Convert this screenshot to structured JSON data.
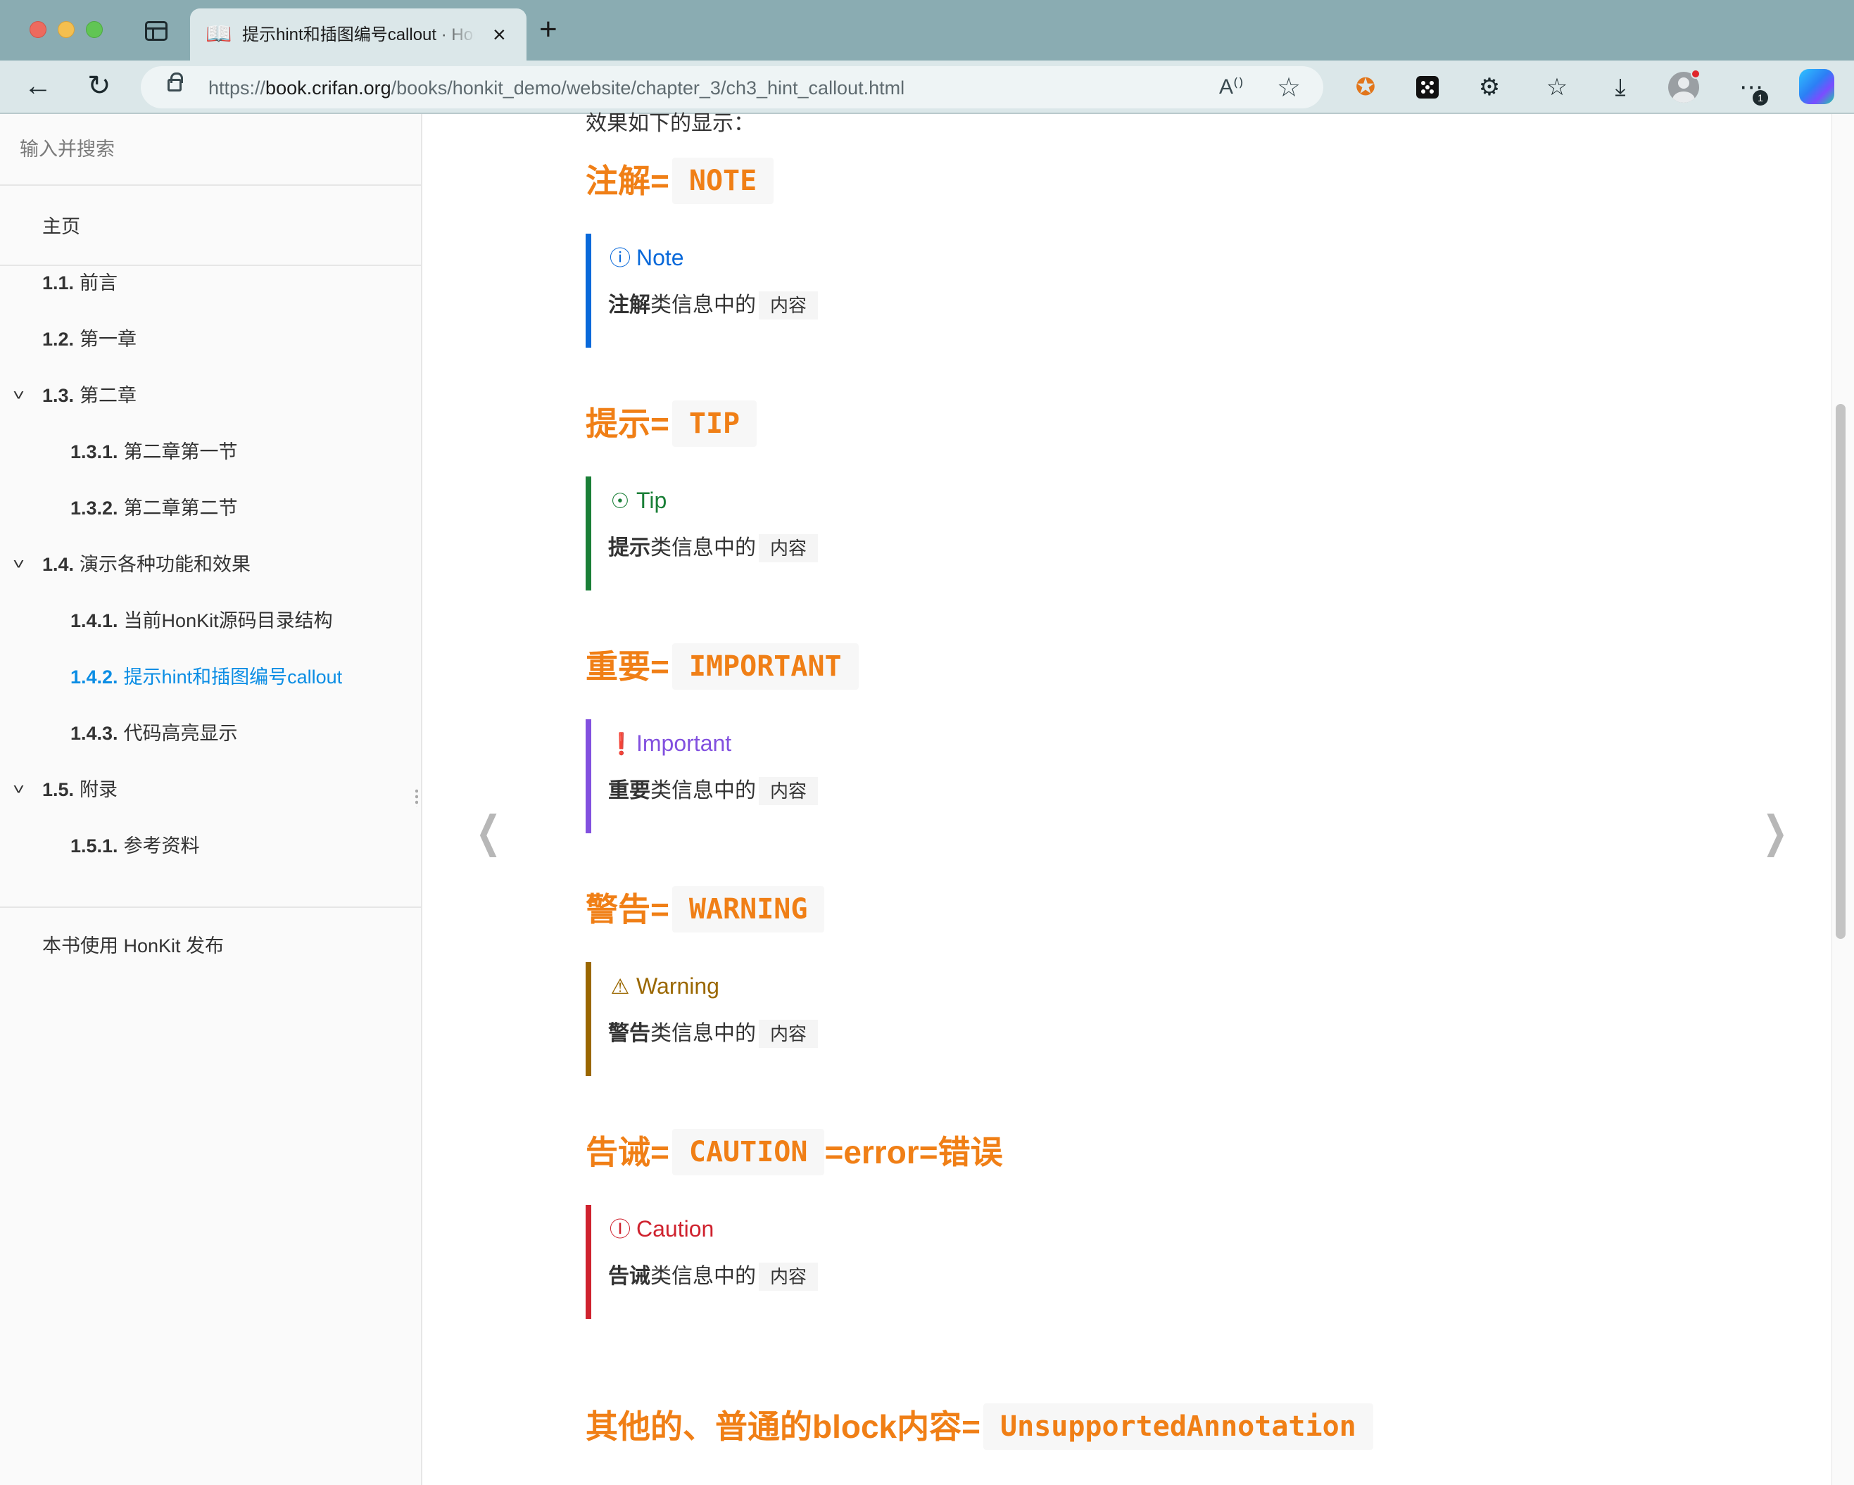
{
  "browser": {
    "tab": {
      "favicon": "open-book-icon",
      "title": "提示hint和插图编号callout · HonKit",
      "close": "×"
    },
    "new_tab": "+",
    "url": {
      "scheme": "https://",
      "host": "book.crifan.org",
      "path": "/books/honkit_demo/website/chapter_3/ch3_hint_callout.html"
    },
    "read_aloud": "A₂",
    "more_badge": "1",
    "extensions": [
      "metamask-fox-icon",
      "dice-extension-icon",
      "extensions-puzzle-icon"
    ]
  },
  "sidebar": {
    "search_placeholder": "输入并搜索",
    "home": "主页",
    "items": [
      {
        "num": "1.1.",
        "label": "前言",
        "level": 1,
        "collapsible": false,
        "active": false
      },
      {
        "num": "1.2.",
        "label": "第一章",
        "level": 1,
        "collapsible": false,
        "active": false
      },
      {
        "num": "1.3.",
        "label": "第二章",
        "level": 1,
        "collapsible": true,
        "active": false
      },
      {
        "num": "1.3.1.",
        "label": "第二章第一节",
        "level": 2,
        "collapsible": false,
        "active": false
      },
      {
        "num": "1.3.2.",
        "label": "第二章第二节",
        "level": 2,
        "collapsible": false,
        "active": false
      },
      {
        "num": "1.4.",
        "label": "演示各种功能和效果",
        "level": 1,
        "collapsible": true,
        "active": false
      },
      {
        "num": "1.4.1.",
        "label": "当前HonKit源码目录结构",
        "level": 2,
        "collapsible": false,
        "active": false
      },
      {
        "num": "1.4.2.",
        "label": "提示hint和插图编号callout",
        "level": 2,
        "collapsible": false,
        "active": true
      },
      {
        "num": "1.4.3.",
        "label": "代码高亮显示",
        "level": 2,
        "collapsible": false,
        "active": false
      },
      {
        "num": "1.5.",
        "label": "附录",
        "level": 1,
        "collapsible": true,
        "active": false
      },
      {
        "num": "1.5.1.",
        "label": "参考资料",
        "level": 2,
        "collapsible": false,
        "active": false
      }
    ],
    "footer": "本书使用 HonKit 发布"
  },
  "content": {
    "intro": "效果如下的显示：",
    "sections": [
      {
        "heading": "注解=",
        "code": "NOTE",
        "suffix": "",
        "callout": {
          "kind": "note",
          "icon": "info-circle-icon",
          "title": "Note",
          "strong": "注解",
          "text": "类信息中的",
          "code": "内容"
        }
      },
      {
        "heading": "提示=",
        "code": "TIP",
        "suffix": "",
        "callout": {
          "kind": "tip",
          "icon": "lightbulb-icon",
          "title": "Tip",
          "strong": "提示",
          "text": "类信息中的",
          "code": "内容"
        }
      },
      {
        "heading": "重要=",
        "code": "IMPORTANT",
        "suffix": "",
        "callout": {
          "kind": "important",
          "icon": "report-speech-icon",
          "title": "Important",
          "strong": "重要",
          "text": "类信息中的",
          "code": "内容"
        }
      },
      {
        "heading": "警告=",
        "code": "WARNING",
        "suffix": "",
        "callout": {
          "kind": "warning",
          "icon": "alert-triangle-icon",
          "title": "Warning",
          "strong": "警告",
          "text": "类信息中的",
          "code": "内容"
        }
      },
      {
        "heading": "告诫=",
        "code": "CAUTION",
        "suffix": "=error=错误",
        "callout": {
          "kind": "caution",
          "icon": "stop-circle-icon",
          "title": "Caution",
          "strong": "告诫",
          "text": "类信息中的",
          "code": "内容"
        }
      }
    ],
    "last_heading": {
      "heading": "其他的、普通的block内容=",
      "code": "UnsupportedAnnotation"
    }
  },
  "colors": {
    "heading": "#f07f16",
    "note": "#0969da",
    "tip": "#1a7f37",
    "important": "#8250df",
    "warning": "#9a6700",
    "caution": "#cf222e",
    "active_link": "#0b8de4"
  }
}
